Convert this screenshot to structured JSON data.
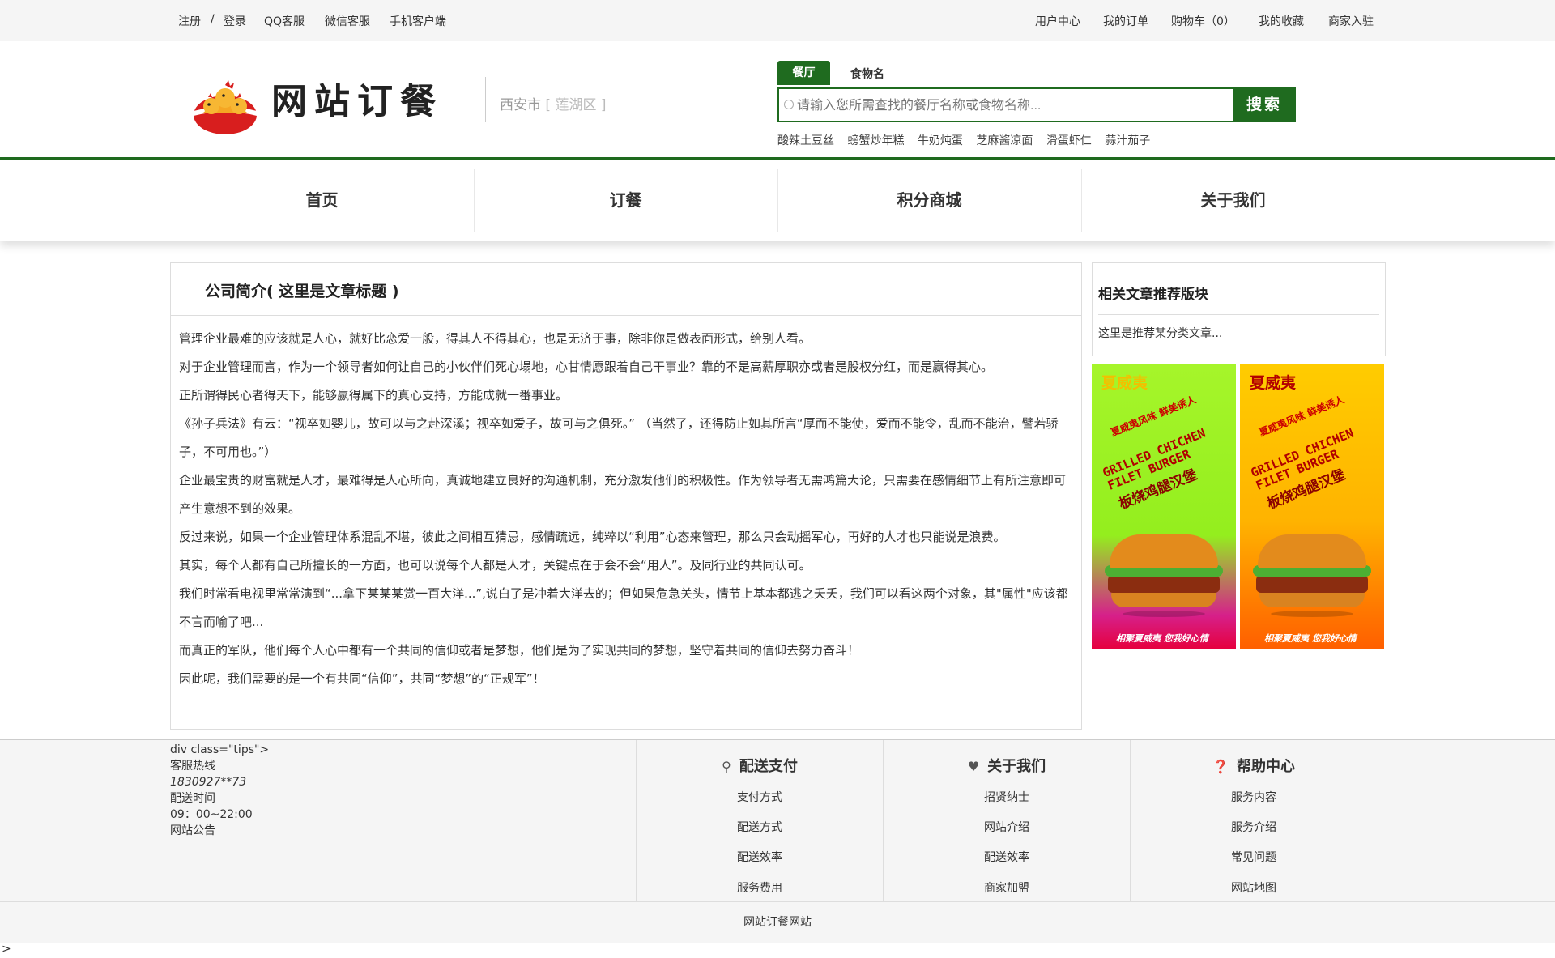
{
  "topbar": {
    "register": "注册",
    "slash": "/",
    "login": "登录",
    "qq_service": "QQ客服",
    "wechat_service": "微信客服",
    "mobile_client": "手机客户端",
    "user_center": "用户中心",
    "my_orders": "我的订单",
    "cart": "购物车（0）",
    "favorites": "我的收藏",
    "merchant_join": "商家入驻"
  },
  "header": {
    "logo_text": "网站订餐",
    "city": "西安市",
    "district": "[ 莲湖区 ]",
    "search": {
      "tab_active": "餐厅",
      "tab_other": "食物名",
      "placeholder": "请输入您所需查找的餐厅名称或食物名称...",
      "button": "搜索"
    },
    "hot_words": [
      "酸辣土豆丝",
      "螃蟹炒年糕",
      "牛奶炖蛋",
      "芝麻酱凉面",
      "滑蛋虾仁",
      "蒜汁茄子"
    ]
  },
  "nav": {
    "items": [
      "首页",
      "订餐",
      "积分商城",
      "关于我们"
    ]
  },
  "article": {
    "title": "公司简介( 这里是文章标题 )",
    "paragraphs": [
      "管理企业最难的应该就是人心，就好比恋爱一般，得其人不得其心，也是无济于事，除非你是做表面形式，给别人看。",
      "对于企业管理而言，作为一个领导者如何让自己的小伙伴们死心塌地，心甘情愿跟着自己干事业？靠的不是高薪厚职亦或者是股权分红，而是赢得其心。",
      "正所谓得民心者得天下，能够赢得属下的真心支持，方能成就一番事业。",
      "《孙子兵法》有云：“视卒如婴儿，故可以与之赴深溪；视卒如爱子，故可与之俱死。” （当然了，还得防止如其所言“厚而不能使，爱而不能令，乱而不能治，譬若骄子，不可用也。”）",
      "企业最宝贵的财富就是人才，最难得是人心所向，真诚地建立良好的沟通机制，充分激发他们的积极性。作为领导者无需鸿篇大论，只需要在感情细节上有所注意即可产生意想不到的效果。",
      "反过来说，如果一个企业管理体系混乱不堪，彼此之间相互猜忌，感情疏远，纯粹以“利用”心态来管理，那么只会动摇军心，再好的人才也只能说是浪费。",
      "其实，每个人都有自己所擅长的一方面，也可以说每个人都是人才，关键点在于会不会“用人”。及同行业的共同认可。",
      "我们时常看电视里常常演到“...拿下某某某赏一百大洋...”,说白了是冲着大洋去的；但如果危急关头，情节上基本都逃之夭夭，我们可以看这两个对象，其\"属性\"应该都不言而喻了吧...",
      "而真正的军队，他们每个人心中都有一个共同的信仰或者是梦想，他们是为了实现共同的梦想，坚守着共同的信仰去努力奋斗！",
      "因此呢，我们需要的是一个有共同“信仰”，共同“梦想”的“正规军”！"
    ]
  },
  "sidebar": {
    "related_title": "相关文章推荐版块",
    "related_item": "这里是推荐某分类文章...",
    "ads": [
      {
        "brand": "夏威夷",
        "slogan": "夏威夷风味 鲜美诱人",
        "en": "GRILLED CHICHEN FILET BURGER",
        "cn": "板烧鸡腿汉堡",
        "footer": "相聚夏威夷 您我好心情",
        "colors": {
          "top": "#a6f52a",
          "bottom": "#e6003d"
        }
      },
      {
        "brand": "夏威夷",
        "slogan": "夏威夷风味 鲜美诱人",
        "en": "GRILLED CHICHEN FILET BURGER",
        "cn": "板烧鸡腿汉堡",
        "footer": "相聚夏威夷 您我好心情",
        "colors": {
          "top": "#ffcc00",
          "bottom": "#ff5f00"
        }
      }
    ]
  },
  "footer": {
    "tips": {
      "stray_markup": "div class=\"tips\">",
      "hotline_label": "客服热线",
      "hotline": "1830927**73",
      "hours_label": "配送时间",
      "hours": "09：00~22:00",
      "notice": "网站公告"
    },
    "columns": [
      {
        "title": "配送支付",
        "icon": "bicycle-icon",
        "links": [
          "支付方式",
          "配送方式",
          "配送效率",
          "服务费用"
        ]
      },
      {
        "title": "关于我们",
        "icon": "heart-icon",
        "links": [
          "招贤纳士",
          "网站介绍",
          "配送效率",
          "商家加盟"
        ]
      },
      {
        "title": "帮助中心",
        "icon": "question-icon",
        "links": [
          "服务内容",
          "服务介绍",
          "常见问题",
          "网站地图"
        ]
      }
    ],
    "copyright": "网站订餐网站",
    "stray_char": ">"
  },
  "colors": {
    "brand_green": "#1f6b1f",
    "topbar_bg": "#f5f5f5",
    "footer_bg": "#f5f5f5"
  }
}
